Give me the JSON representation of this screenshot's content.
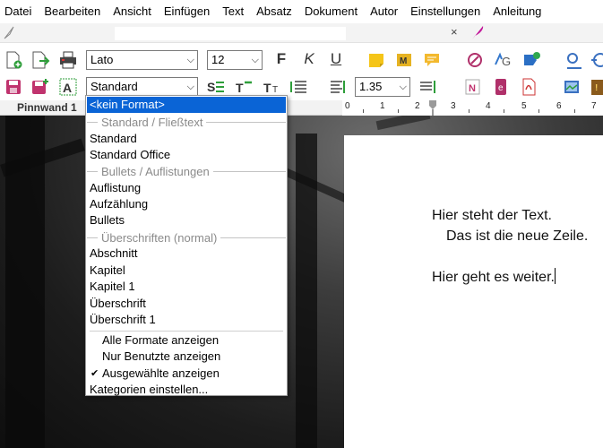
{
  "menubar": {
    "items": [
      "Datei",
      "Bearbeiten",
      "Ansicht",
      "Einfügen",
      "Text",
      "Absatz",
      "Dokument",
      "Autor",
      "Einstellungen",
      "Anleitung"
    ]
  },
  "tabbar": {
    "close_symbol": "×"
  },
  "toolbar": {
    "font_name": "Lato",
    "font_size": "12",
    "style_name": "Standard",
    "line_spacing": "1.35",
    "bold_label": "F",
    "italic_label": "K",
    "underline_label": "U",
    "dropdown_arrow": "⌵"
  },
  "ruler": {
    "label": "Pinnwand 1",
    "numbers": [
      "0",
      "1",
      "2",
      "3",
      "4",
      "5",
      "6",
      "7"
    ]
  },
  "document": {
    "lines": [
      "Hier steht der Text.",
      "Das ist die neue Zeile.",
      "Hier geht es weiter."
    ]
  },
  "style_dropdown": {
    "selected_item": "<kein Format>",
    "groups": {
      "standard": {
        "title": "Standard / Fließtext",
        "items": [
          "Standard",
          "Standard Office"
        ]
      },
      "bullets": {
        "title": "Bullets / Auflistungen",
        "items": [
          "Auflistung",
          "Aufzählung",
          "Bullets"
        ]
      },
      "headings": {
        "title": "Überschriften (normal)",
        "items": [
          "Abschnitt",
          "Kapitel",
          "Kapitel 1",
          "Überschrift",
          "Überschrift 1"
        ]
      }
    },
    "options": {
      "show_all": "Alle Formate anzeigen",
      "only_used": "Nur Benutzte anzeigen",
      "show_selected": "Ausgewählte anzeigen",
      "show_selected_checked": true,
      "check_symbol": "✔",
      "categories": "Kategorien einstellen..."
    }
  },
  "colors": {
    "selection": "#0a64d6",
    "group_text": "#8a8a8a",
    "ruler_background": "#f2f2f2"
  }
}
